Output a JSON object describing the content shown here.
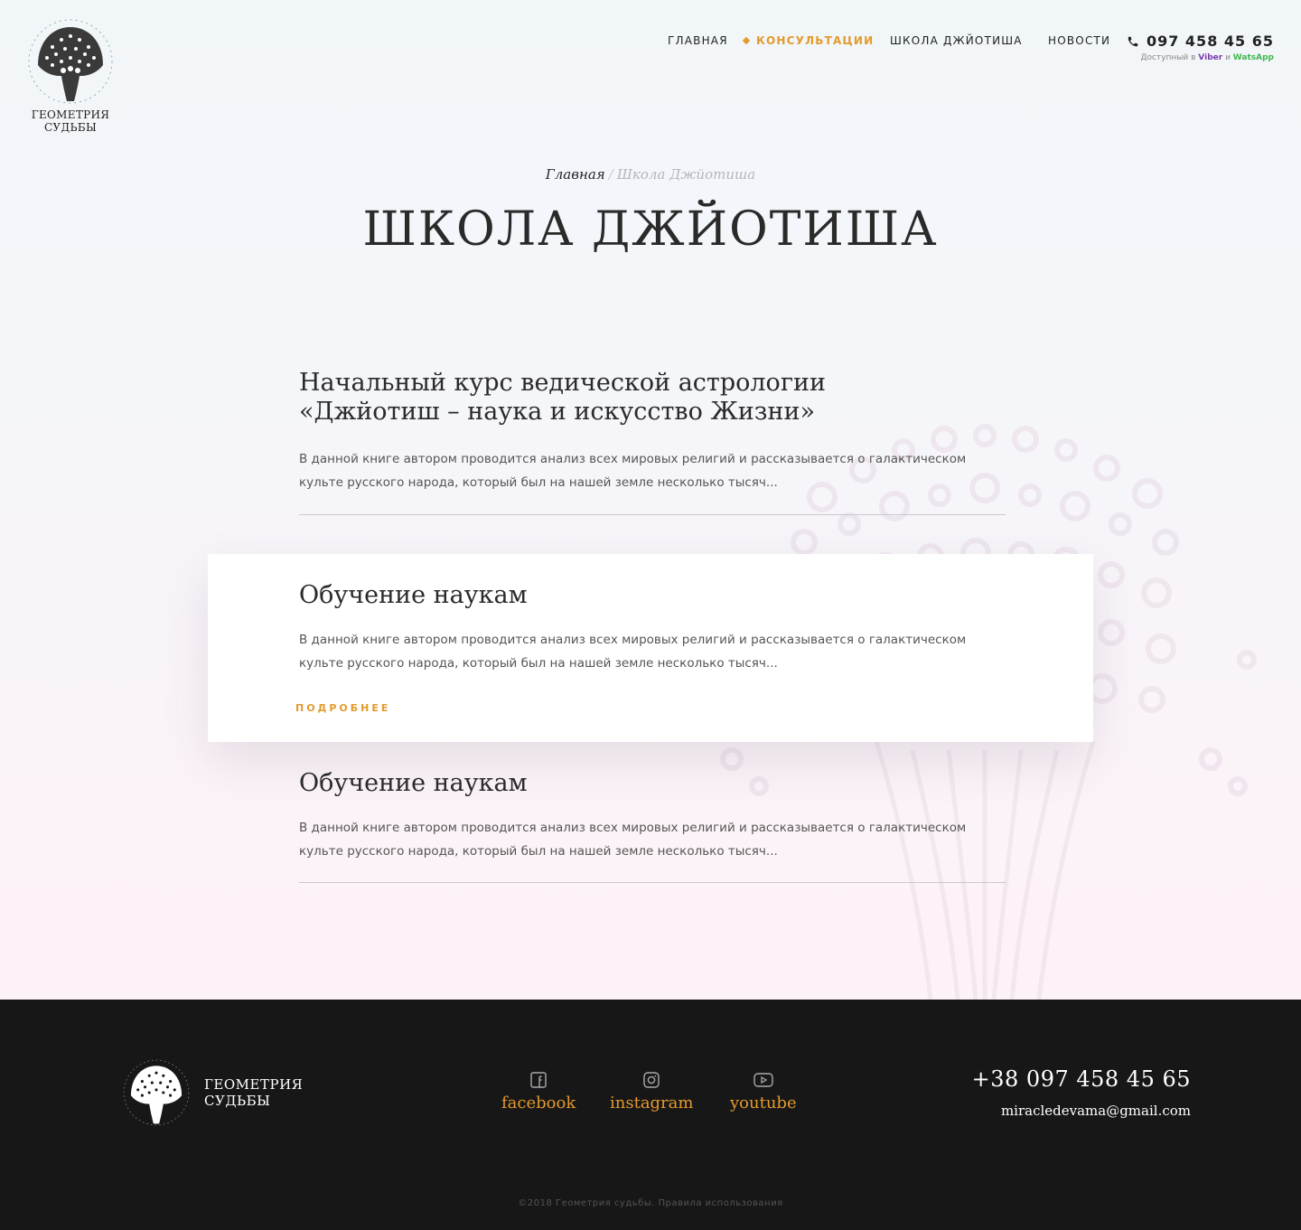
{
  "header": {
    "logo_line1": "ГЕОМЕТРИЯ",
    "logo_line2": "СУДЬБЫ",
    "nav": [
      {
        "label": "ГЛАВНАЯ",
        "active": false
      },
      {
        "label": "КОНСУЛЬТАЦИИ",
        "active": true
      },
      {
        "label": "ШКОЛА ДЖЙОТИША",
        "active": false
      },
      {
        "label": "НОВОСТИ",
        "active": false
      }
    ],
    "phone": "097 458 45 65",
    "availability_prefix": "Доступный в",
    "availability_viber": "Viber",
    "availability_and": "и",
    "availability_whatsapp": "WatsApp"
  },
  "breadcrumb": {
    "home": "Главная",
    "separator": "/",
    "current": "Школа Джйотиша"
  },
  "page_title": "ШКОЛА ДЖЙОТИША",
  "articles": [
    {
      "title_line1": "Начальный курс ведической астрологии",
      "title_line2": "«Джйотиш – наука и искусство Жизни»",
      "text": "В данной книге автором проводится анализ всех мировых религий и рассказывается о галактическом культе русского народа, который был на нашей земле несколько тысяч..."
    },
    {
      "title_line1": "Обучение наукам",
      "text": "В данной книге автором проводится анализ всех мировых религий и рассказывается о галактическом культе русского народа, который был на нашей земле несколько тысяч...",
      "more_label": "ПОДРОБНЕЕ"
    },
    {
      "title_line1": "Обучение наукам",
      "text": "В данной книге автором проводится анализ всех мировых религий и рассказывается о галактическом культе русского народа, который был на нашей земле несколько тысяч..."
    }
  ],
  "footer": {
    "logo_line1": "ГЕОМЕТРИЯ",
    "logo_line2": "СУДЬБЫ",
    "social": [
      {
        "label": "facebook",
        "icon": "facebook-icon"
      },
      {
        "label": "instagram",
        "icon": "instagram-icon"
      },
      {
        "label": "youtube",
        "icon": "youtube-icon"
      }
    ],
    "phone": "+38 097 458 45 65",
    "email": "miracledevama@gmail.com",
    "copyright": "©2018 Геометрия судьбы. Правила использования"
  },
  "colors": {
    "accent": "#e39a2c",
    "viber": "#7b3bb0",
    "whatsapp": "#3fb84f",
    "footer_bg": "#171717"
  }
}
